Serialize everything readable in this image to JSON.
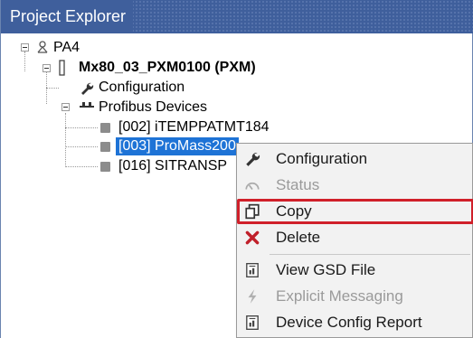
{
  "panel": {
    "title": "Project Explorer"
  },
  "tree": {
    "root": {
      "label": "PA4",
      "icon": "network-icon"
    },
    "device": {
      "label": "Mx80_03_PXM0100 (PXM)",
      "icon": "device-icon"
    },
    "configuration": {
      "label": "Configuration",
      "icon": "wrench-icon"
    },
    "profibus": {
      "label": "Profibus Devices",
      "icon": "bus-icon"
    },
    "children": [
      {
        "label": "[002] iTEMPPATMT184",
        "selected": false
      },
      {
        "label": "[003] ProMass200",
        "selected": true
      },
      {
        "label": "[016] SITRANSP",
        "selected": false
      }
    ]
  },
  "context_menu": {
    "items": [
      {
        "label": "Configuration",
        "icon": "wrench-icon",
        "enabled": true
      },
      {
        "label": "Status",
        "icon": "gauge-icon",
        "enabled": false
      },
      {
        "label": "Copy",
        "icon": "copy-icon",
        "enabled": true,
        "highlighted": true
      },
      {
        "label": "Delete",
        "icon": "delete-x-icon",
        "enabled": true
      },
      {
        "label": "View GSD File",
        "icon": "document-icon",
        "enabled": true
      },
      {
        "label": "Explicit Messaging",
        "icon": "lightning-icon",
        "enabled": false
      },
      {
        "label": "Device Config Report",
        "icon": "report-icon",
        "enabled": true
      }
    ],
    "highlight_color": "#d0202a"
  },
  "colors": {
    "title_bar": "#3f5f9c",
    "selection": "#1e73d6",
    "delete_icon": "#c0202a"
  }
}
